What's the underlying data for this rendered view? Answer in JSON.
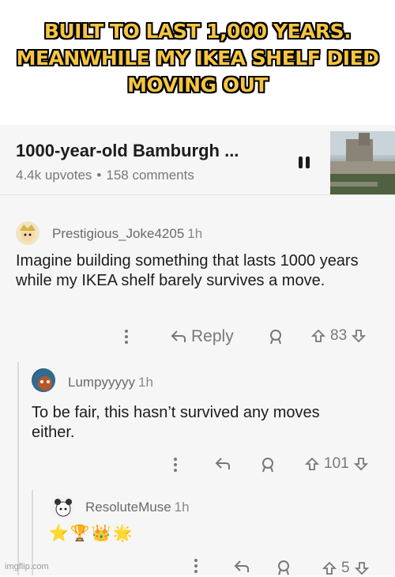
{
  "caption": "BUILT TO LAST 1,000 YEARS. MEANWHILE MY IKEA SHELF DIED MOVING OUT",
  "post": {
    "title": "1000-year-old Bamburgh ...",
    "upvotes": "4.4k upvotes",
    "separator": "•",
    "comments": "158 comments"
  },
  "comments": [
    {
      "author": "Prestigious_Joke4205",
      "time": "1h",
      "text": "Imagine building something that lasts 1000 years while my IKEA shelf barely survives a move.",
      "reply_label": "Reply",
      "score": "83"
    },
    {
      "author": "Lumpyyyyy",
      "time": "1h",
      "text": "To be fair, this hasn’t survived any moves either.",
      "score": "101"
    },
    {
      "author": "ResoluteMuse",
      "time": "1h",
      "text": "⭐🏆👑🌟",
      "score": "5"
    }
  ],
  "icons": {
    "more": "more-vertical-icon",
    "reply": "reply-arrow-icon",
    "award": "award-icon",
    "upvote": "upvote-arrow-icon",
    "downvote": "downvote-arrow-icon",
    "pause": "pause-icon"
  },
  "watermark": "imgflip.com"
}
